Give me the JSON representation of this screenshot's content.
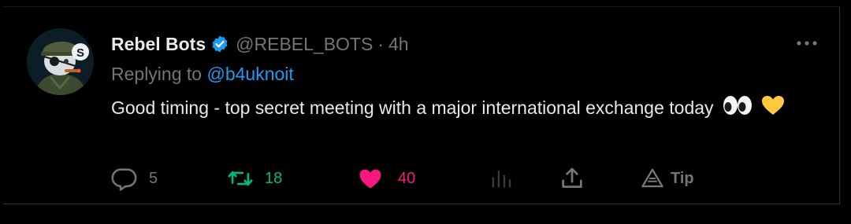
{
  "tweet": {
    "author_name": "Rebel Bots",
    "handle": "@REBEL_BOTS",
    "separator": "·",
    "time": "4h",
    "replying_prefix": "Replying to",
    "replying_to": "@b4uknoit",
    "text": "Good timing - top secret meeting with a major international exchange today",
    "emojis": [
      "eyes-emoji",
      "yellow-heart-emoji"
    ]
  },
  "actions": {
    "reply_count": "5",
    "retweet_count": "18",
    "like_count": "40",
    "tip_label": "Tip"
  },
  "colors": {
    "background": "#000000",
    "primary_text": "#e7e9ea",
    "secondary_text": "#71767b",
    "link_blue": "#1d9bf0",
    "retweet_green": "#00ba7c",
    "like_pink": "#f91880",
    "yellow_heart": "#ffc83d"
  },
  "icons": {
    "verified": "verified-badge-icon",
    "more": "more-options-icon",
    "reply": "reply-icon",
    "retweet": "retweet-icon",
    "like": "heart-icon",
    "analytics": "analytics-icon",
    "share": "share-icon",
    "tip": "tip-icon"
  }
}
